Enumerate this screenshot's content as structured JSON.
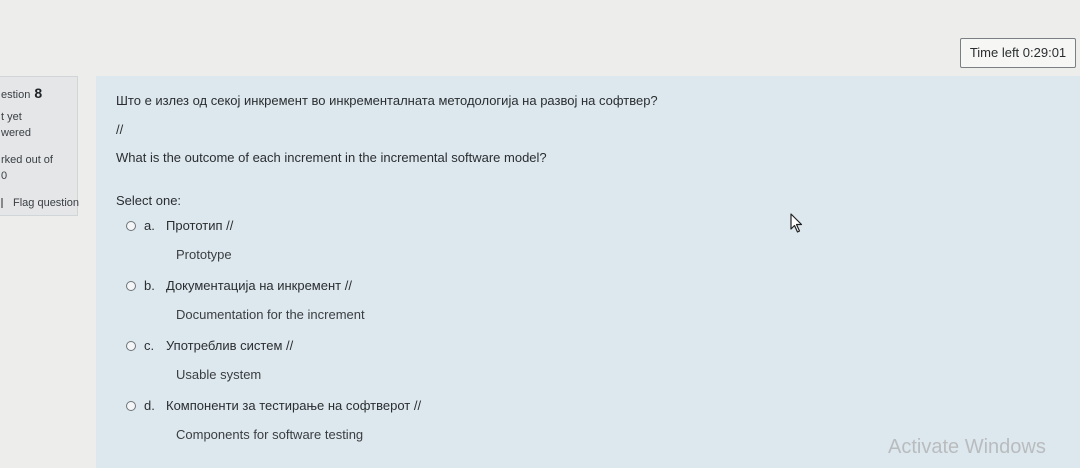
{
  "timer": {
    "label": "Time left 0:29:01"
  },
  "info": {
    "question_label": "estion",
    "question_number": "8",
    "state_line1": "t yet",
    "state_line2": "wered",
    "marked_line1": "rked out of",
    "marked_line2": "0",
    "flag_label": "Flag question"
  },
  "question": {
    "text_mk": "Што е излез од секој инкремент во инкременталната методологија на развој на софтвер?",
    "separator": "//",
    "text_en": "What is the outcome of each increment in the incremental software model?",
    "select_one": "Select one:",
    "options": [
      {
        "letter": "a.",
        "mk": "Прототип //",
        "en": "Prototype"
      },
      {
        "letter": "b.",
        "mk": "Документација на инкремент //",
        "en": "Documentation for the increment"
      },
      {
        "letter": "c.",
        "mk": "Употреблив систем //",
        "en": "Usable system"
      },
      {
        "letter": "d.",
        "mk": "Компоненти за тестирање на софтверот //",
        "en": "Components for software testing"
      }
    ]
  },
  "watermark": {
    "text": "Activate Windows"
  },
  "icons": {
    "cursor": "mouse-pointer-icon",
    "flag": "flag-icon"
  }
}
